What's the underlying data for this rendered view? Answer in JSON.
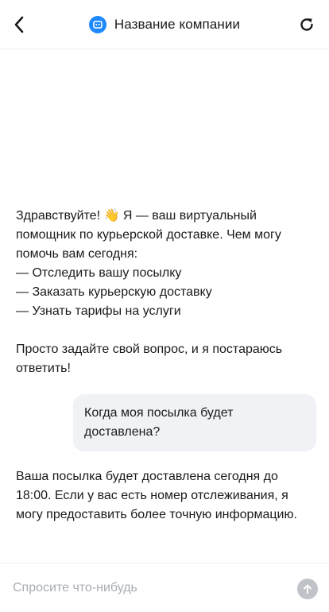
{
  "header": {
    "title": "Название компании",
    "back_icon": "chevron-left-icon",
    "logo_icon": "chat-bot-icon",
    "refresh_icon": "refresh-icon",
    "brand_color": "#1e88ff"
  },
  "messages": {
    "bot_greeting": {
      "line1": "Здравствуйте! 👋 Я — ваш виртуальный",
      "line2": "помощник по курьерской доставке. Чем могу",
      "line3": "помочь вам сегодня:",
      "option1": "— Отследить вашу посылку",
      "option2": "— Заказать курьерскую доставку",
      "option3": "— Узнать тарифы на услуги",
      "closing1": "Просто задайте свой вопрос, и я постараюсь",
      "closing2": "ответить!"
    },
    "user_question": {
      "line1": "Когда моя посылка будет",
      "line2": "доставлена?"
    },
    "bot_answer": {
      "line1": "Ваша посылка будет доставлена сегодня до",
      "line2": "18:00. Если у вас есть номер отслеживания, я",
      "line3": "могу предоставить более точную информацию."
    }
  },
  "composer": {
    "placeholder": "Спросите что-нибудь",
    "value": "",
    "send_icon": "arrow-up-icon"
  }
}
